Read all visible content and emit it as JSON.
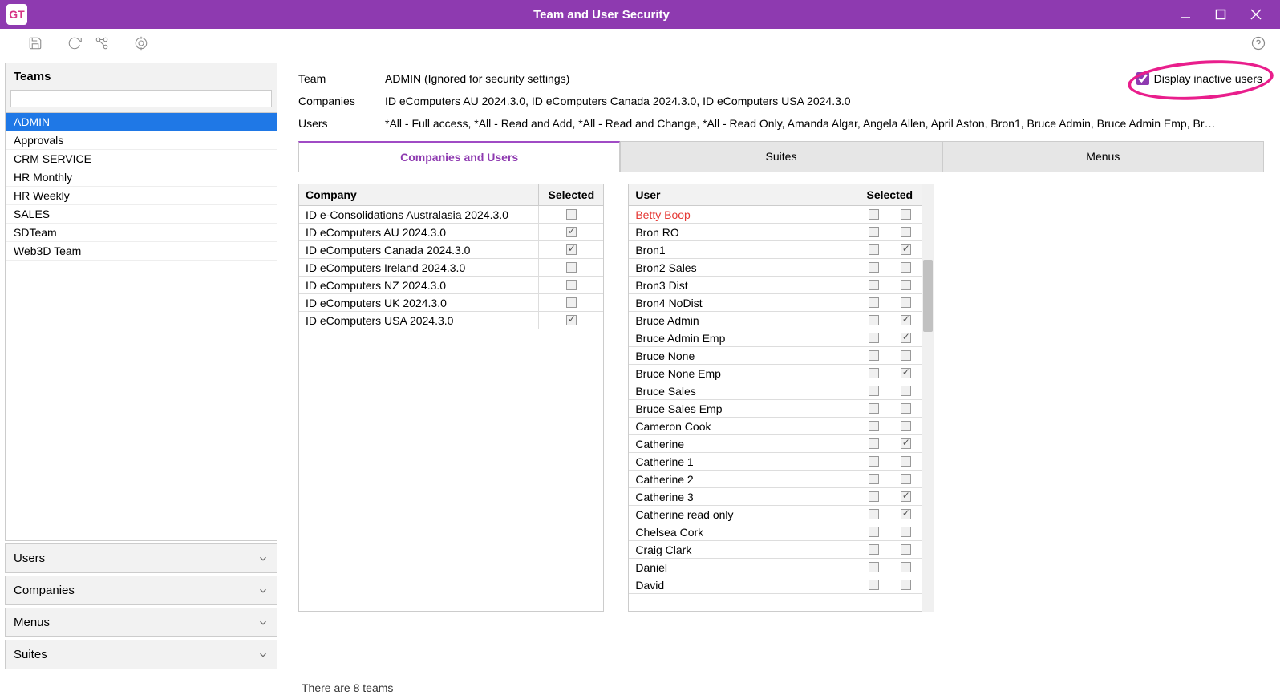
{
  "window": {
    "title": "Team and User Security",
    "app_badge": "GT"
  },
  "toolbar": {
    "save_label": "Save",
    "refresh_label": "Refresh",
    "link_label": "Link",
    "settings_label": "Settings",
    "help_label": "Help"
  },
  "sidebar": {
    "teams_header": "Teams",
    "teams_search": "",
    "teams": [
      {
        "label": "ADMIN",
        "selected": true
      },
      {
        "label": "Approvals"
      },
      {
        "label": "CRM SERVICE"
      },
      {
        "label": "HR Monthly"
      },
      {
        "label": "HR Weekly"
      },
      {
        "label": "SALES"
      },
      {
        "label": "SDTeam"
      },
      {
        "label": "Web3D Team"
      }
    ],
    "collapsed": [
      "Users",
      "Companies",
      "Menus",
      "Suites"
    ]
  },
  "info": {
    "team_label": "Team",
    "team_value": "ADMIN (Ignored for security settings)",
    "companies_label": "Companies",
    "companies_value": "ID eComputers AU 2024.3.0, ID eComputers Canada 2024.3.0, ID eComputers USA 2024.3.0",
    "users_label": "Users",
    "users_value": "*All - Full access, *All - Read and Add, *All - Read and Change, *All - Read Only, Amanda Algar, Angela Allen, April Aston, Bron1, Bruce Admin, Bruce Admin Emp, Br…"
  },
  "display_inactive": {
    "label": "Display inactive users",
    "checked": true
  },
  "tabs": [
    "Companies and Users",
    "Suites",
    "Menus"
  ],
  "active_tab": 0,
  "company_grid": {
    "columns": [
      "Company",
      "Selected"
    ],
    "rows": [
      {
        "name": "ID e-Consolidations Australasia 2024.3.0",
        "selected": false
      },
      {
        "name": "ID eComputers AU 2024.3.0",
        "selected": true
      },
      {
        "name": "ID eComputers Canada 2024.3.0",
        "selected": true
      },
      {
        "name": "ID eComputers Ireland 2024.3.0",
        "selected": false
      },
      {
        "name": "ID eComputers NZ 2024.3.0",
        "selected": false
      },
      {
        "name": "ID eComputers UK 2024.3.0",
        "selected": false
      },
      {
        "name": "ID eComputers USA 2024.3.0",
        "selected": true
      }
    ]
  },
  "user_grid": {
    "columns": [
      "User",
      "Selected"
    ],
    "rows": [
      {
        "name": "Betty Boop",
        "inactive": true,
        "selected": false
      },
      {
        "name": "Bron RO",
        "selected": false
      },
      {
        "name": "Bron1",
        "selected": true
      },
      {
        "name": "Bron2 Sales",
        "selected": false
      },
      {
        "name": "Bron3 Dist",
        "selected": false
      },
      {
        "name": "Bron4 NoDist",
        "selected": false
      },
      {
        "name": "Bruce Admin",
        "selected": true
      },
      {
        "name": "Bruce Admin Emp",
        "selected": true
      },
      {
        "name": "Bruce None",
        "selected": false
      },
      {
        "name": "Bruce None Emp",
        "selected": true
      },
      {
        "name": "Bruce Sales",
        "selected": false
      },
      {
        "name": "Bruce Sales Emp",
        "selected": false
      },
      {
        "name": "Cameron Cook",
        "selected": false
      },
      {
        "name": "Catherine",
        "selected": true
      },
      {
        "name": "Catherine 1",
        "selected": false
      },
      {
        "name": "Catherine 2",
        "selected": false
      },
      {
        "name": "Catherine 3",
        "selected": true
      },
      {
        "name": "Catherine read only",
        "selected": true
      },
      {
        "name": "Chelsea Cork",
        "selected": false
      },
      {
        "name": "Craig Clark",
        "selected": false
      },
      {
        "name": "Daniel",
        "selected": false
      },
      {
        "name": "David",
        "selected": false
      }
    ]
  },
  "status": "There are 8 teams"
}
